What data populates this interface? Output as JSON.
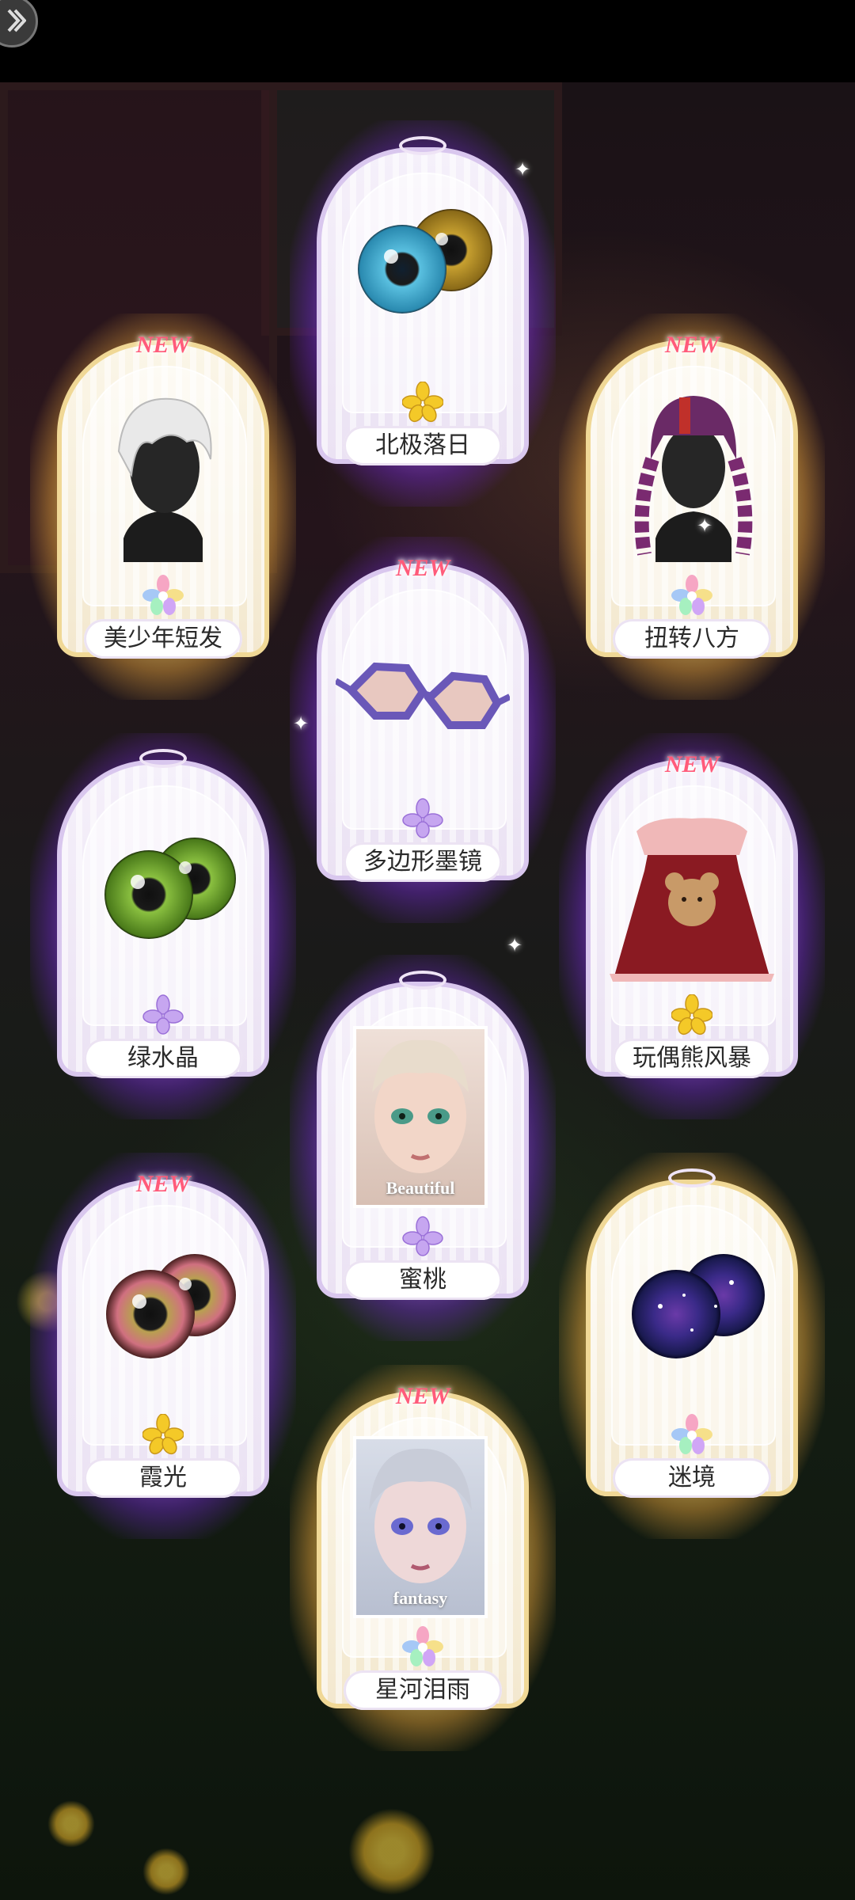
{
  "badge_text": "NEW",
  "cards": [
    {
      "name": "北极落日",
      "new": false,
      "rarity": "purple",
      "gem": "gold-flower",
      "item": "eyes-blue-amber"
    },
    {
      "name": "美少年短发",
      "new": true,
      "rarity": "gold",
      "gem": "rainbow-flower",
      "item": "white-short-hair"
    },
    {
      "name": "扭转八方",
      "new": true,
      "rarity": "gold",
      "gem": "rainbow-flower",
      "item": "purple-braided-hair"
    },
    {
      "name": "多边形墨镜",
      "new": true,
      "rarity": "purple",
      "gem": "purple-flower",
      "item": "polygon-sunglasses"
    },
    {
      "name": "绿水晶",
      "new": false,
      "rarity": "purple",
      "gem": "purple-flower",
      "item": "eyes-green"
    },
    {
      "name": "玩偶熊风暴",
      "new": true,
      "rarity": "purple",
      "gem": "gold-flower",
      "item": "teddy-bear-dress"
    },
    {
      "name": "蜜桃",
      "new": false,
      "rarity": "purple",
      "gem": "purple-flower",
      "item": "portrait-peach",
      "portrait_text": "Beautiful"
    },
    {
      "name": "霞光",
      "new": true,
      "rarity": "purple",
      "gem": "gold-flower",
      "item": "eyes-pink-brown"
    },
    {
      "name": "迷境",
      "new": false,
      "rarity": "gold",
      "gem": "rainbow-flower",
      "item": "eyes-galaxy"
    },
    {
      "name": "星河泪雨",
      "new": true,
      "rarity": "gold",
      "gem": "rainbow-flower",
      "item": "portrait-fantasy",
      "portrait_text": "fantasy"
    }
  ],
  "colors": {
    "purple_glow": "#aa5aff",
    "gold_glow": "#ffe178",
    "new_badge": "#ff5b7a"
  }
}
